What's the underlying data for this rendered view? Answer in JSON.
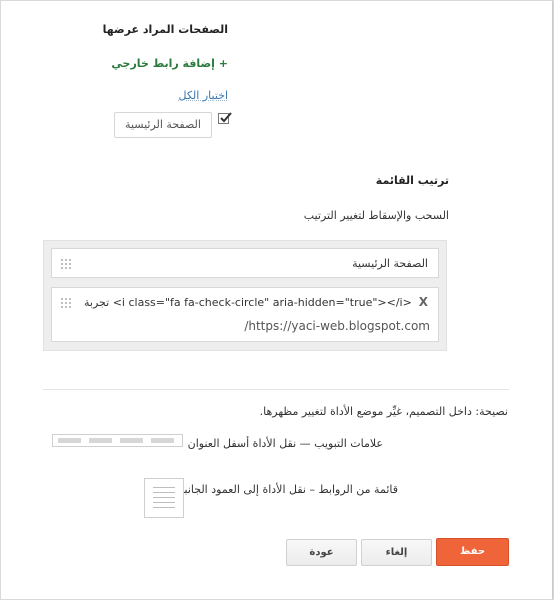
{
  "pages_section": {
    "title": "الصفحات المراد عرضها",
    "add_external_link": "+ إضافة رابط خارجي",
    "select_all": "اختيار الكل",
    "pages": [
      {
        "label": "الصفحة الرئيسية",
        "checked": true
      }
    ]
  },
  "order_section": {
    "title": "ترتيب القائمة",
    "hint": "السحب والإسقاط لتغيير الترتيب",
    "items": [
      {
        "label": "الصفحة الرئيسية"
      },
      {
        "label": "تجربة <i class=\"fa fa-check-circle\" aria-hidden=\"true\"></i>",
        "url": "https://yaci-web.blogspot.com/",
        "remove_label": "X"
      }
    ]
  },
  "tip": {
    "text": "نصيحة: داخل التصميم، غيِّر موضع الأداة لتغيير مظهرها.",
    "options": [
      {
        "label": "علامات التبويب — نقل الأداة أسفل العنوان"
      },
      {
        "label": "قائمة من الروابط – نقل الأداة إلى العمود الجانبي"
      }
    ]
  },
  "buttons": {
    "save": "حفظ",
    "cancel": "إلغاء",
    "back": "عودة"
  },
  "colors": {
    "primary_button": "#f0643a",
    "link_green": "#2b7a3e",
    "link_blue": "#3b78b5"
  }
}
